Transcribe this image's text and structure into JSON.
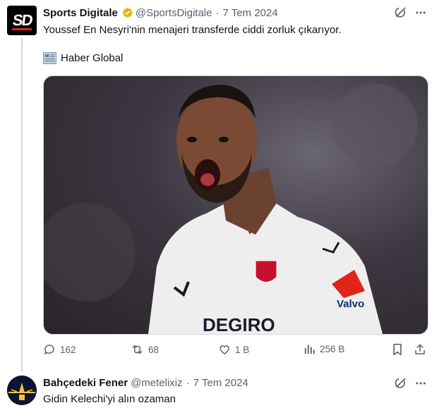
{
  "tweet": {
    "author_name": "Sports Digitale",
    "handle": "@SportsDigitale",
    "separator": "·",
    "date": "7 Tem 2024",
    "text": "Youssef En Nesyri'nin menajeri transferde ciddi zorluk çıkarıyor.",
    "source_emoji": "📰",
    "source_text": "Haber Global",
    "avatar_text": "SD",
    "stats": {
      "replies": "162",
      "reposts": "68",
      "likes": "1 B",
      "views": "256 B"
    }
  },
  "reply": {
    "author_name": "Bahçedeki Fener",
    "handle": "@metelixiz",
    "separator": "·",
    "date": "7 Tem 2024",
    "text": "Gidin Kelechi'yi alın ozaman"
  },
  "colors": {
    "muted": "#536471",
    "text": "#0f1419",
    "verified": "#e2b719",
    "border": "#cfd9de"
  },
  "icons": [
    "grok-icon",
    "more-icon",
    "reply-icon",
    "repost-icon",
    "like-icon",
    "views-icon",
    "bookmark-icon",
    "share-icon",
    "verified-badge-icon"
  ]
}
